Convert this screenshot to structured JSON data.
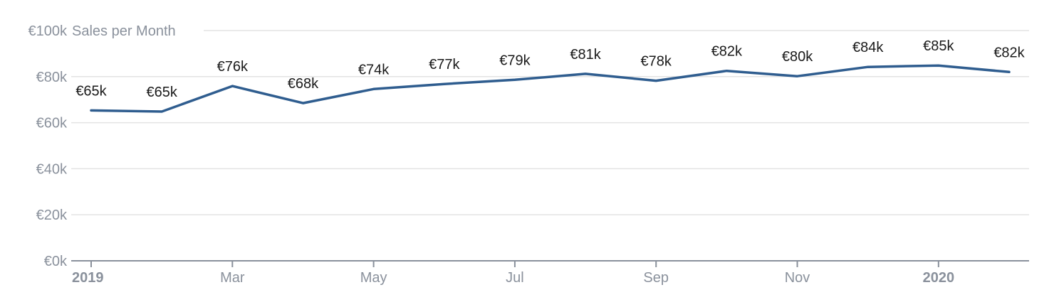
{
  "chart_data": {
    "type": "line",
    "title": "Sales per Month",
    "currency_prefix": "€",
    "unit_suffix": "k",
    "x": [
      "2019-01",
      "2019-02",
      "2019-03",
      "2019-04",
      "2019-05",
      "2019-06",
      "2019-07",
      "2019-08",
      "2019-09",
      "2019-10",
      "2019-11",
      "2019-12",
      "2020-01",
      "2020-02"
    ],
    "series": [
      {
        "values": [
          65.3,
          64.8,
          75.9,
          68.5,
          74.6,
          76.8,
          78.6,
          81.2,
          78.2,
          82.5,
          80.2,
          84.2,
          84.8,
          82.0
        ],
        "labels": [
          "€65k",
          "€65k",
          "€76k",
          "€68k",
          "€74k",
          "€77k",
          "€79k",
          "€81k",
          "€78k",
          "€82k",
          "€80k",
          "€84k",
          "€85k",
          "€82k"
        ],
        "color": "#2f5d8f"
      }
    ],
    "ylim": [
      0,
      100
    ],
    "yticks": [
      0,
      20,
      40,
      60,
      80,
      100
    ],
    "ytick_labels": [
      "€0k",
      "€20k",
      "€40k",
      "€60k",
      "€80k",
      "€100k"
    ],
    "xtick_labels": [
      {
        "x": "2019-01",
        "label": "2019",
        "bold": true
      },
      {
        "x": "2019-03",
        "label": "Mar",
        "bold": false
      },
      {
        "x": "2019-05",
        "label": "May",
        "bold": false
      },
      {
        "x": "2019-07",
        "label": "Jul",
        "bold": false
      },
      {
        "x": "2019-09",
        "label": "Sep",
        "bold": false
      },
      {
        "x": "2019-11",
        "label": "Nov",
        "bold": false
      },
      {
        "x": "2020-01",
        "label": "2020",
        "bold": true
      }
    ],
    "grid": true,
    "axis_color": "#8a919c",
    "grid_color": "#e3e3e3"
  }
}
